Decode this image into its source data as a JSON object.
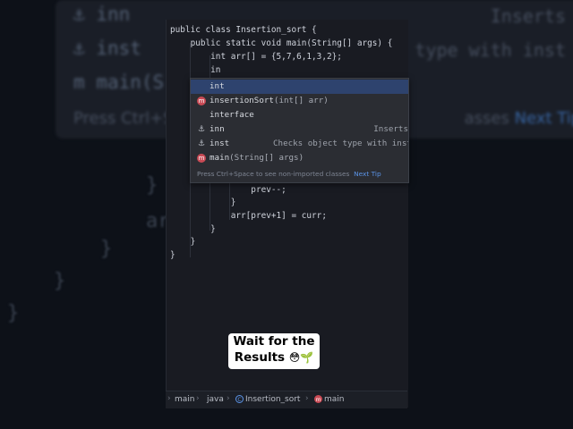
{
  "background": {
    "popup_rows": [
      {
        "icon": "⚓",
        "label": "inn",
        "right": "Inserts"
      },
      {
        "icon": "⚓",
        "label": "inst",
        "right": "type with inst"
      },
      {
        "icon": "m",
        "label": "main(S",
        "right": ""
      }
    ],
    "hint_prefix": "Press Ctrl+S",
    "hint_mid": "asses",
    "hint_link": "Next Tip",
    "ghost_code": [
      "}",
      "arr",
      "}",
      "}",
      "}"
    ]
  },
  "code": {
    "lines": [
      "public class Insertion_sort {",
      "    public static void main(String[] args) {",
      "        int arr[] = {5,7,6,1,3,2};",
      "        in",
      "                prev--;",
      "            }",
      "            arr[prev+1] = curr;",
      "        }",
      "    }",
      "}"
    ]
  },
  "completion": {
    "items": [
      {
        "icon": "",
        "label": "int",
        "sig": "",
        "desc": "",
        "selected": true
      },
      {
        "icon": "m",
        "label": "insertionSort",
        "sig": "(int[] arr)",
        "desc": ""
      },
      {
        "icon": "",
        "label": "interface",
        "sig": "",
        "desc": ""
      },
      {
        "icon": "⚓",
        "label": "inn",
        "sig": "",
        "desc": "Inserts"
      },
      {
        "icon": "⚓",
        "label": "inst",
        "sig": "",
        "desc": "Checks object type with inst"
      },
      {
        "icon": "m",
        "label": "main",
        "sig": "(String[] args)",
        "desc": ""
      }
    ],
    "footer_text": "Press Ctrl+Space to see non-imported classes",
    "footer_link": "Next Tip"
  },
  "caption": {
    "line1": "Wait for the",
    "line2": "Results",
    "emoji": "😳🌱"
  },
  "breadcrumb": {
    "items": [
      "main",
      "java",
      "Insertion_sort",
      "main"
    ]
  }
}
